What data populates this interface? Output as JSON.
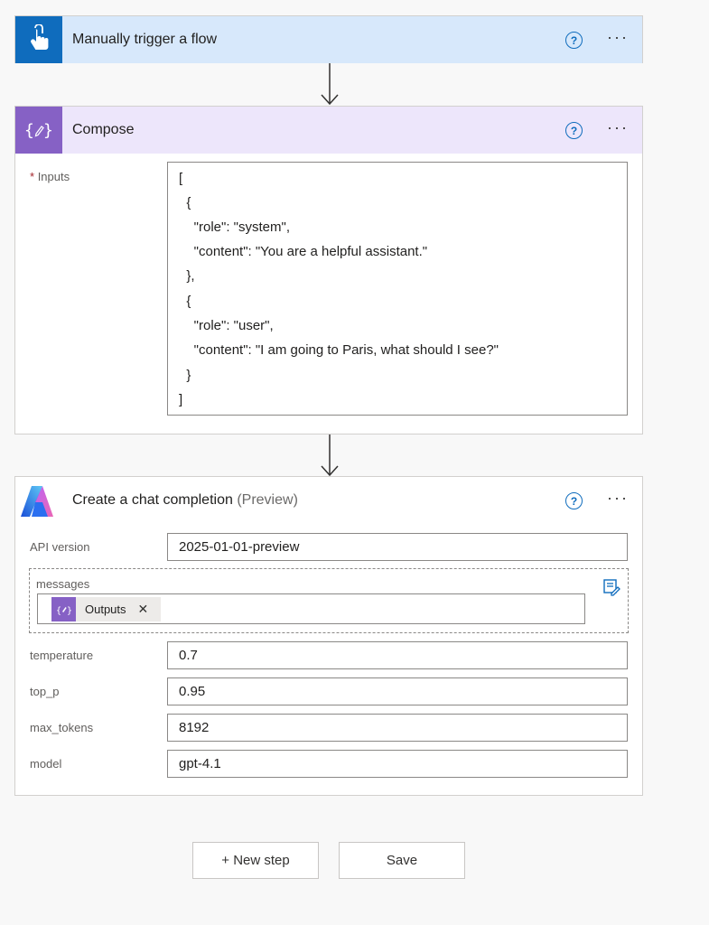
{
  "trigger": {
    "title": "Manually trigger a flow",
    "help_glyph": "?",
    "more_glyph": "···",
    "color": "#0f6cbd",
    "header_bg": "#d7e8fb"
  },
  "compose": {
    "title": "Compose",
    "help_glyph": "?",
    "more_glyph": "···",
    "color": "#8661c5",
    "header_bg": "#ede6fb",
    "inputs_required_mark": "*",
    "inputs_label": "Inputs",
    "inputs_lines": [
      "[",
      "  {",
      "    \"role\": \"system\",",
      "    \"content\": \"You are a helpful assistant.\"",
      "  },",
      "  {",
      "    \"role\": \"user\",",
      "    \"content\": \"I am going to Paris, what should I see?\"",
      "  }",
      "]"
    ]
  },
  "chat": {
    "title": "Create a chat completion",
    "title_suffix": "(Preview)",
    "help_glyph": "?",
    "more_glyph": "···",
    "fields": {
      "api_version": {
        "label": "API version",
        "value": "2025-01-01-preview"
      },
      "messages": {
        "label": "messages",
        "token_label": "Outputs",
        "remove_glyph": "✕"
      },
      "temperature": {
        "label": "temperature",
        "value": "0.7"
      },
      "top_p": {
        "label": "top_p",
        "value": "0.95"
      },
      "max_tokens": {
        "label": "max_tokens",
        "value": "8192"
      },
      "model": {
        "label": "model",
        "value": "gpt-4.1"
      }
    }
  },
  "actions": {
    "new_step_label": "+ New step",
    "save_label": "Save"
  },
  "icons": {
    "trigger": "tap-hand-icon",
    "compose": "compose-braces-icon",
    "chat": "azure-openai-icon",
    "edit": "edit-array-icon"
  }
}
